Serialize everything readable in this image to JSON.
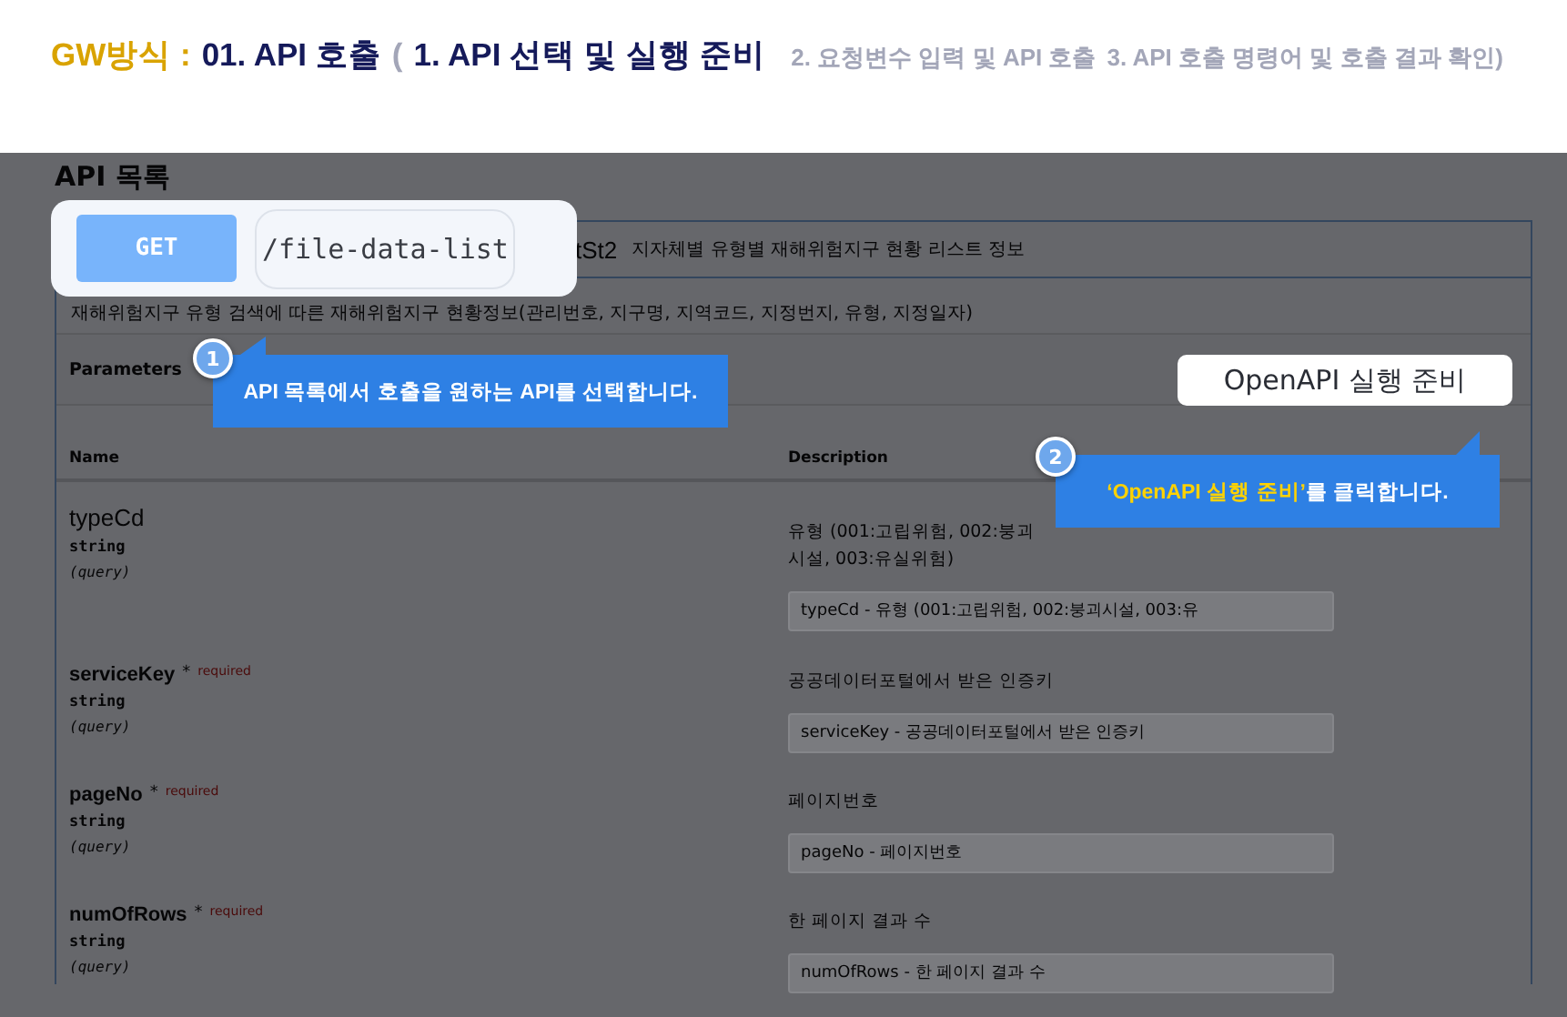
{
  "header": {
    "parts": [
      {
        "kind": "brand",
        "text": "GW방식 :"
      },
      {
        "kind": "current",
        "text": "01. API 호출"
      },
      {
        "kind": "muted",
        "text": "("
      },
      {
        "kind": "current",
        "text": "1. API 선택 및 실행 준비"
      },
      {
        "kind": "muted",
        "text": "2. 요청변수 입력 및 API 호출"
      },
      {
        "kind": "muted",
        "text": "3. API 호출 명령어 및 호출 결과 확인)"
      }
    ]
  },
  "page": {
    "title": "API 목록",
    "summary": {
      "path_tail": "tSt2",
      "title": "지자체별 유형별 재해위험지구 현황 리스트 정보"
    },
    "description": "재해위험지구 유형 검색에 따른 재해위험지구 현황정보(관리번호, 지구명, 지역코드, 지정번지, 유형, 지정일자)",
    "parameters_label": "Parameters",
    "columns": [
      "Name",
      "Description"
    ],
    "parameters": [
      {
        "name": "typeCd",
        "required": false,
        "type": "string",
        "in": "(query)",
        "description": "유형 (001:고립위험, 002:붕괴시설, 003:유실위험)",
        "placeholder": "typeCd - 유형 (001:고립위험, 002:붕괴시설, 003:유"
      },
      {
        "name": "serviceKey",
        "required": true,
        "required_mark": "*",
        "required_label": "required",
        "type": "string",
        "in": "(query)",
        "description": "공공데이터포털에서 받은 인증키",
        "placeholder": "serviceKey - 공공데이터포털에서 받은 인증키"
      },
      {
        "name": "pageNo",
        "required": true,
        "required_mark": "*",
        "required_label": "required",
        "type": "string",
        "in": "(query)",
        "description": "페이지번호",
        "placeholder": "pageNo - 페이지번호"
      },
      {
        "name": "numOfRows",
        "required": true,
        "required_mark": "*",
        "required_label": "required",
        "type": "string",
        "in": "(query)",
        "description": "한 페이지 결과 수",
        "placeholder": "numOfRows - 한 페이지 결과 수"
      }
    ]
  },
  "highlight": {
    "method": "GET",
    "path": "/file-data-list"
  },
  "prepare_button": "OpenAPI 실행 준비",
  "callouts": [
    {
      "number": "1",
      "text": "API 목록에서 호출을 원하는 API를 선택합니다."
    },
    {
      "number": "2",
      "text": "**‘OpenAPI 실행 준비’**를 클릭합니다."
    }
  ]
}
